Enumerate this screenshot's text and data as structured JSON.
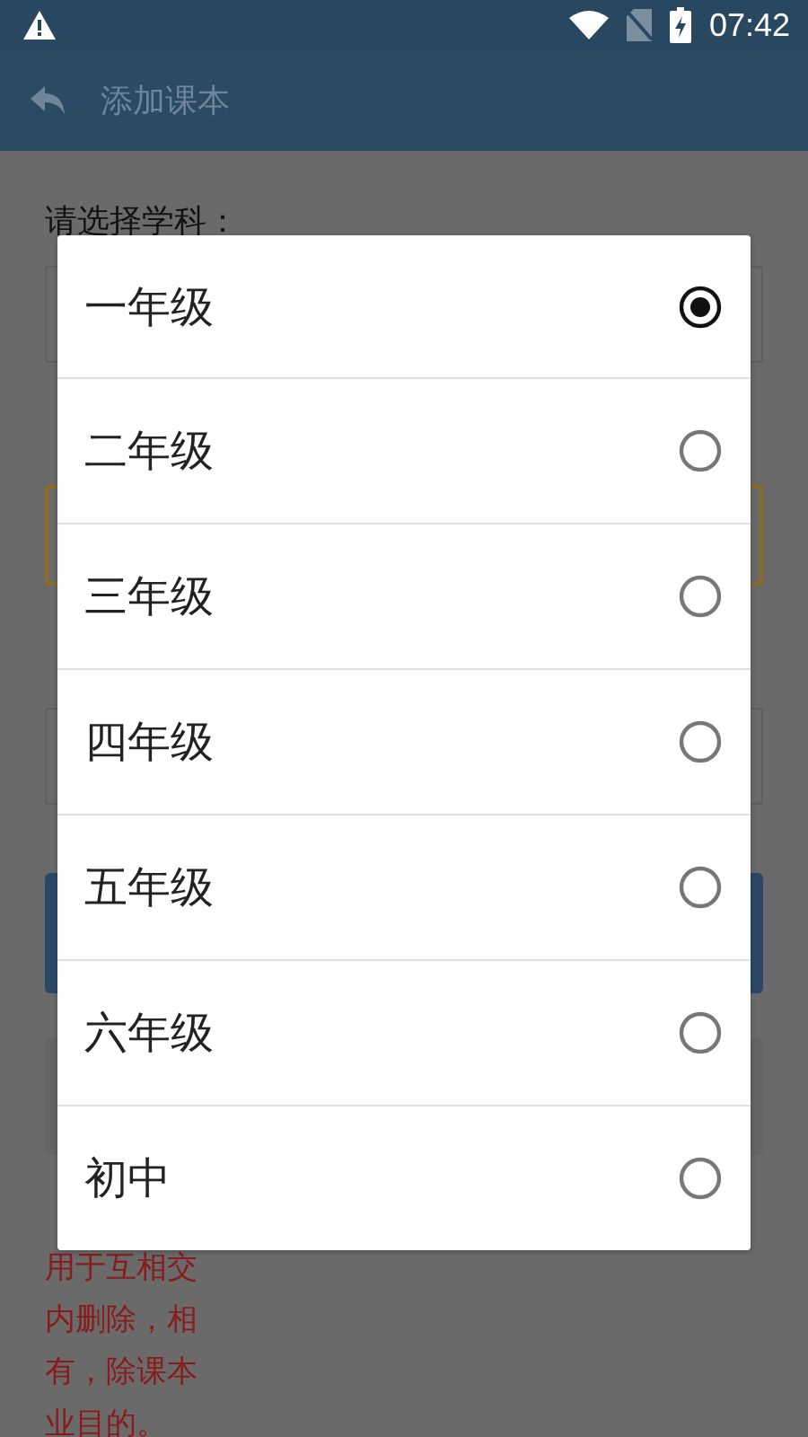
{
  "status_bar": {
    "time": "07:42"
  },
  "toolbar": {
    "title": "添加课本"
  },
  "form": {
    "subject_label": "请选择学科：",
    "notice_lines": [
      "用于互相交",
      "内删除，相",
      "有，除课本",
      "业目的。"
    ]
  },
  "dialog": {
    "options": [
      {
        "label": "一年级",
        "selected": true
      },
      {
        "label": "二年级",
        "selected": false
      },
      {
        "label": "三年级",
        "selected": false
      },
      {
        "label": "四年级",
        "selected": false
      },
      {
        "label": "五年级",
        "selected": false
      },
      {
        "label": "六年级",
        "selected": false
      },
      {
        "label": "初中",
        "selected": false
      }
    ]
  }
}
